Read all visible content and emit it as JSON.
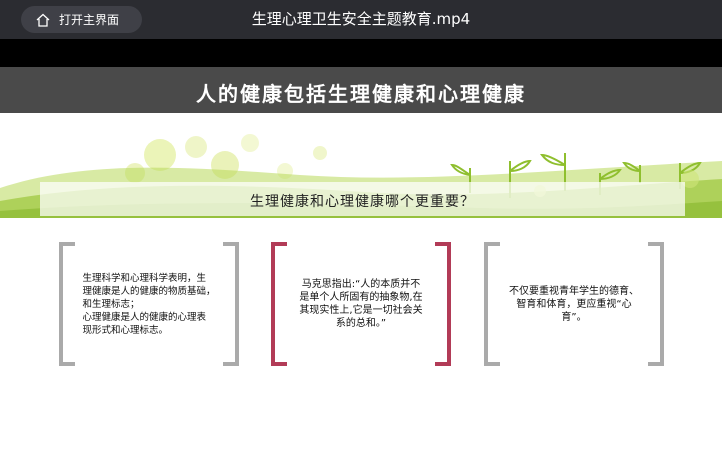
{
  "player": {
    "open_button_label": "打开主界面",
    "title": "生理心理卫生安全主题教育.mp4"
  },
  "slide": {
    "banner_title": "人的健康包括生理健康和心理健康",
    "question": "生理健康和心理健康哪个更重要？",
    "cards": [
      {
        "lines": [
          "生理科学和心理科学表明，生",
          "理健康是人的健康的物质基础，",
          "和生理标志；",
          "心理健康是人的健康的心理表",
          "现形式和心理标志。"
        ]
      },
      {
        "lines": [
          "马克思指出:“人的本质并不",
          "是单个人所固有的抽象物,在",
          "其现实性上,它是一切社会关",
          "系的总和。”"
        ]
      },
      {
        "lines": [
          "不仅要重视青年学生的德育、",
          "智育和体育，更应重视“心",
          "育”。"
        ]
      }
    ],
    "colors": {
      "banner": "#4a4a4a",
      "grass": "#9cc63a",
      "card_gray": "#aaaaaa",
      "card_accent": "#b23b57"
    }
  }
}
